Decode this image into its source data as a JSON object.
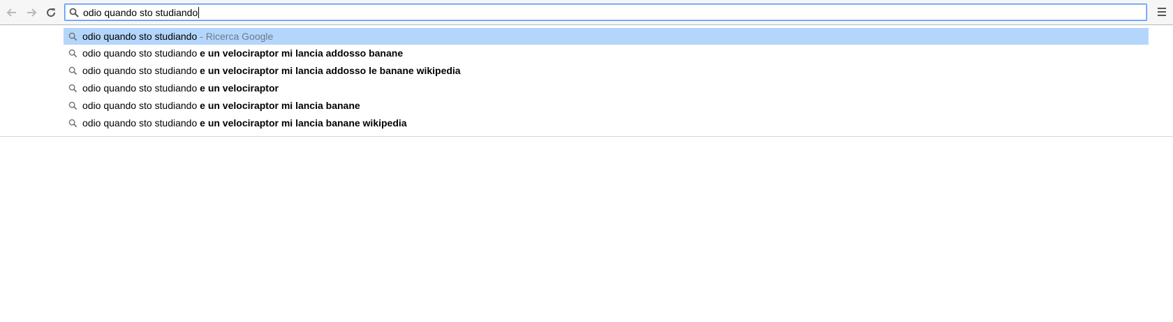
{
  "omnibox": {
    "value": "odio quando sto studiando"
  },
  "suggestions": [
    {
      "typed": "odio quando sto studiando",
      "completion": "",
      "hint": "- Ricerca Google"
    },
    {
      "typed": "odio quando sto studiando",
      "completion": "e un velociraptor mi lancia addosso banane",
      "hint": ""
    },
    {
      "typed": "odio quando sto studiando",
      "completion": "e un velociraptor mi lancia addosso le banane wikipedia",
      "hint": ""
    },
    {
      "typed": "odio quando sto studiando",
      "completion": "e un velociraptor",
      "hint": ""
    },
    {
      "typed": "odio quando sto studiando",
      "completion": "e un velociraptor mi lancia banane",
      "hint": ""
    },
    {
      "typed": "odio quando sto studiando",
      "completion": "e un velociraptor mi lancia banane wikipedia",
      "hint": ""
    }
  ],
  "icons": {
    "back": "back-arrow-icon",
    "forward": "forward-arrow-icon",
    "reload": "reload-icon",
    "search": "search-icon",
    "menu": "menu-icon"
  },
  "colors": {
    "selected_row": "#b4d6fb",
    "focus_border": "#4d90fe"
  }
}
